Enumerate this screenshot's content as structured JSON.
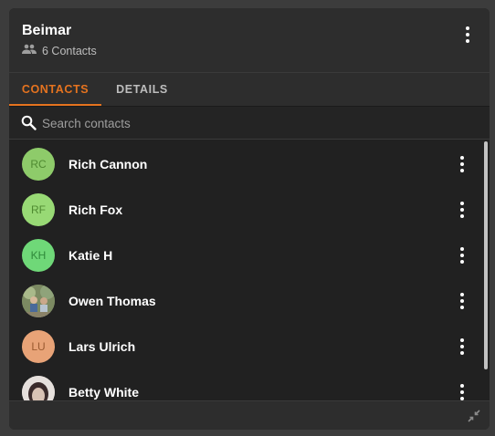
{
  "group": {
    "title": "Beimar",
    "subtitle": "6 Contacts"
  },
  "tabs": [
    {
      "label": "CONTACTS",
      "active": true
    },
    {
      "label": "DETAILS",
      "active": false
    }
  ],
  "search": {
    "placeholder": "Search contacts",
    "value": ""
  },
  "contacts": [
    {
      "name": "Rich Cannon",
      "initials": "RC",
      "avatar_color": "#8ecb6a",
      "initials_color": "#4f8a31"
    },
    {
      "name": "Rich Fox",
      "initials": "RF",
      "avatar_color": "#98d975",
      "initials_color": "#4f8a31"
    },
    {
      "name": "Katie H",
      "initials": "KH",
      "avatar_color": "#6fd878",
      "initials_color": "#2f8a3a"
    },
    {
      "name": "Owen Thomas",
      "initials": "",
      "avatar_color": "#6f7d5a",
      "initials_color": "#ffffff"
    },
    {
      "name": "Lars Ulrich",
      "initials": "LU",
      "avatar_color": "#e8a377",
      "initials_color": "#9a5a30"
    },
    {
      "name": "Betty White",
      "initials": "",
      "avatar_color": "#d8d0cc",
      "initials_color": "#ffffff"
    }
  ],
  "colors": {
    "accent": "#e5731f",
    "panel_bg": "#212121",
    "header_bg": "#2d2d2d"
  },
  "icons": {
    "group": "people-icon",
    "menu": "more-vert-icon",
    "search": "search-icon",
    "footer": "collapse-icon"
  }
}
